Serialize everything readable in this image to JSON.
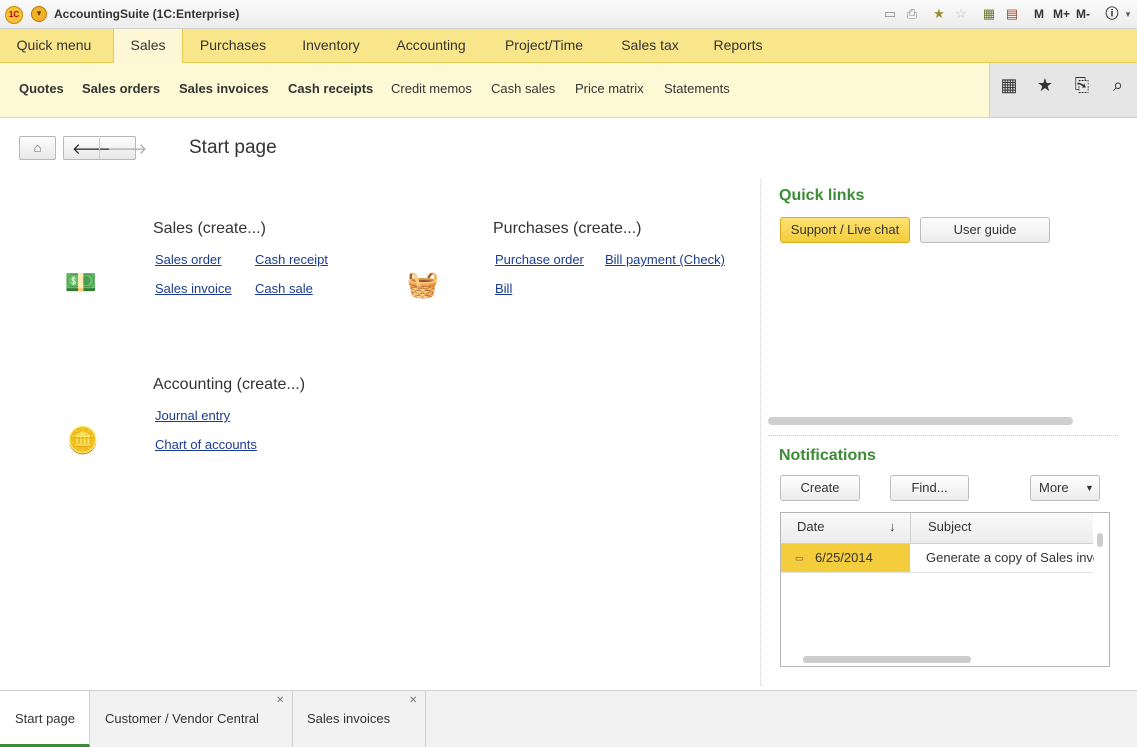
{
  "window": {
    "title": "AccountingSuite  (1C:Enterprise)",
    "logo_text": "1C",
    "memory_buttons": [
      "M",
      "M+",
      "M-"
    ]
  },
  "sections": [
    {
      "label": "Quick menu"
    },
    {
      "label": "Sales",
      "active": true
    },
    {
      "label": "Purchases"
    },
    {
      "label": "Inventory"
    },
    {
      "label": "Accounting"
    },
    {
      "label": "Project/Time"
    },
    {
      "label": "Sales tax"
    },
    {
      "label": "Reports"
    }
  ],
  "function_bar": [
    {
      "label": "Quotes",
      "bold": true
    },
    {
      "label": "Sales orders",
      "bold": true
    },
    {
      "label": "Sales invoices",
      "bold": true
    },
    {
      "label": "Cash receipts",
      "bold": true
    },
    {
      "label": "Credit memos",
      "bold": false
    },
    {
      "label": "Cash sales",
      "bold": false
    },
    {
      "label": "Price matrix",
      "bold": false
    },
    {
      "label": "Statements",
      "bold": false
    }
  ],
  "page_title": "Start page",
  "groups": {
    "sales": {
      "title": "Sales (create...)",
      "links": [
        "Sales order",
        "Cash receipt",
        "Sales invoice",
        "Cash sale"
      ]
    },
    "purchases": {
      "title": "Purchases (create...)",
      "links": [
        "Purchase order",
        "Bill payment (Check)",
        "Bill"
      ]
    },
    "accounting": {
      "title": "Accounting (create...)",
      "links": [
        "Journal entry",
        "Chart of accounts"
      ]
    }
  },
  "quick_links": {
    "title": "Quick links",
    "buttons": [
      "Support / Live chat",
      "User guide"
    ]
  },
  "notifications": {
    "title": "Notifications",
    "buttons": {
      "create": "Create",
      "find": "Find...",
      "more": "More"
    },
    "columns": [
      "Date",
      "Subject"
    ],
    "sort_glyph": "↓",
    "rows": [
      {
        "date": "6/25/2014",
        "subject": "Generate a copy of Sales invoice"
      }
    ]
  },
  "open_tabs": [
    {
      "label": "Start page",
      "active": true
    },
    {
      "label": "Customer / Vendor Central",
      "closable": true
    },
    {
      "label": "Sales invoices",
      "closable": true
    }
  ],
  "colors": {
    "section_bar": "#f9e68a",
    "function_bar": "#fef9d5",
    "accent_green": "#3b8c35",
    "link_blue": "#1a3b8f",
    "highlight_yellow": "#f4cd3c"
  }
}
